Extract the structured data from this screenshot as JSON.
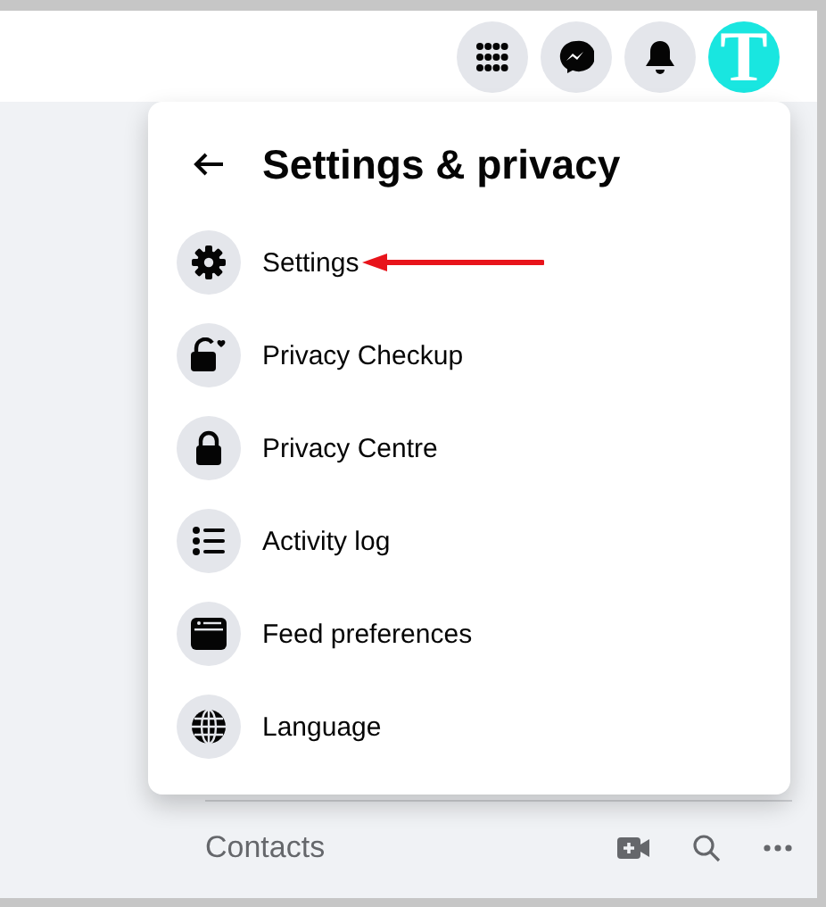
{
  "header": {
    "avatar_letter": "T"
  },
  "menu": {
    "title": "Settings & privacy",
    "items": [
      {
        "kind": "gear",
        "label": "Settings",
        "annotated": true
      },
      {
        "kind": "privacy-lock",
        "label": "Privacy Checkup",
        "annotated": false
      },
      {
        "kind": "lock",
        "label": "Privacy Centre",
        "annotated": false
      },
      {
        "kind": "list",
        "label": "Activity log",
        "annotated": false
      },
      {
        "kind": "feed",
        "label": "Feed preferences",
        "annotated": false
      },
      {
        "kind": "globe",
        "label": "Language",
        "annotated": false
      }
    ]
  },
  "contacts": {
    "title": "Contacts"
  }
}
